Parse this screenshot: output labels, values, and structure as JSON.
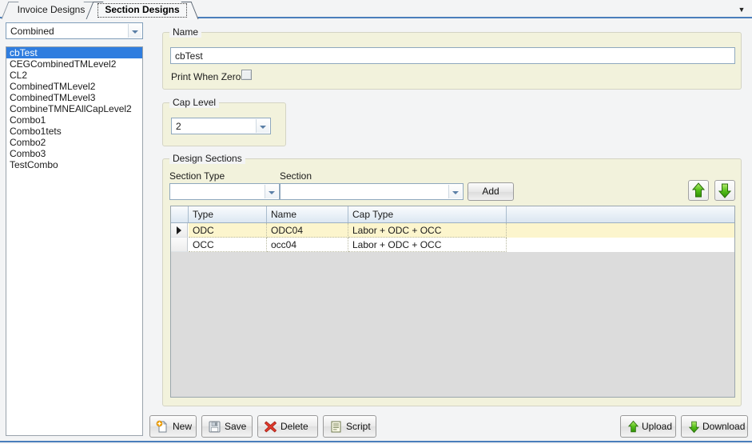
{
  "window": {
    "tabstrip_menu_icon": "chevron-down-icon"
  },
  "tabs": [
    {
      "label": "Invoice Designs",
      "active": false
    },
    {
      "label": "Section Designs",
      "active": true
    }
  ],
  "sidebar": {
    "filter_combo": {
      "value": "Combined",
      "icon": "chevron-down-icon"
    },
    "list_items": [
      {
        "label": "cbTest",
        "selected": true
      },
      {
        "label": "CEGCombinedTMLevel2",
        "selected": false
      },
      {
        "label": "CL2",
        "selected": false
      },
      {
        "label": "CombinedTMLevel2",
        "selected": false
      },
      {
        "label": "CombinedTMLevel3",
        "selected": false
      },
      {
        "label": "CombineTMNEAllCapLevel2",
        "selected": false
      },
      {
        "label": "Combo1",
        "selected": false
      },
      {
        "label": "Combo1tets",
        "selected": false
      },
      {
        "label": "Combo2",
        "selected": false
      },
      {
        "label": "Combo3",
        "selected": false
      },
      {
        "label": "TestCombo",
        "selected": false
      }
    ]
  },
  "name_group": {
    "legend": "Name",
    "value": "cbTest",
    "placeholder": "",
    "print_when_zero": {
      "label": "Print When Zero",
      "checked": false
    }
  },
  "cap_level_group": {
    "legend": "Cap Level",
    "value": "2",
    "icon": "chevron-down-icon"
  },
  "design_sections": {
    "legend": "Design Sections",
    "section_type": {
      "label": "Section Type",
      "value": "",
      "icon": "chevron-down-icon"
    },
    "section": {
      "label": "Section",
      "value": "",
      "icon": "chevron-down-icon"
    },
    "add_button": "Add",
    "move_up_icon": "arrow-up-icon",
    "move_down_icon": "arrow-down-icon",
    "grid": {
      "columns": [
        "Type",
        "Name",
        "Cap Type"
      ],
      "rows": [
        {
          "cells": [
            "ODC",
            "ODC04",
            "Labor + ODC + OCC"
          ],
          "current": true
        },
        {
          "cells": [
            "OCC",
            "occ04",
            "Labor + ODC + OCC"
          ],
          "current": false
        }
      ]
    }
  },
  "footer": {
    "new": {
      "label": "New",
      "icon": "new-document-icon"
    },
    "save": {
      "label": "Save",
      "icon": "floppy-disk-icon"
    },
    "delete": {
      "label": "Delete",
      "icon": "red-x-icon"
    },
    "script": {
      "label": "Script",
      "icon": "script-document-icon"
    },
    "upload": {
      "label": "Upload",
      "icon": "green-arrow-up-icon"
    },
    "download": {
      "label": "Download",
      "icon": "green-arrow-down-icon"
    }
  },
  "colors": {
    "accent": "#4a7ebb",
    "panel": "#f2f2dc",
    "selection": "#2f7ddf",
    "current_row": "#fcf5cd",
    "green": "#4caf16"
  }
}
